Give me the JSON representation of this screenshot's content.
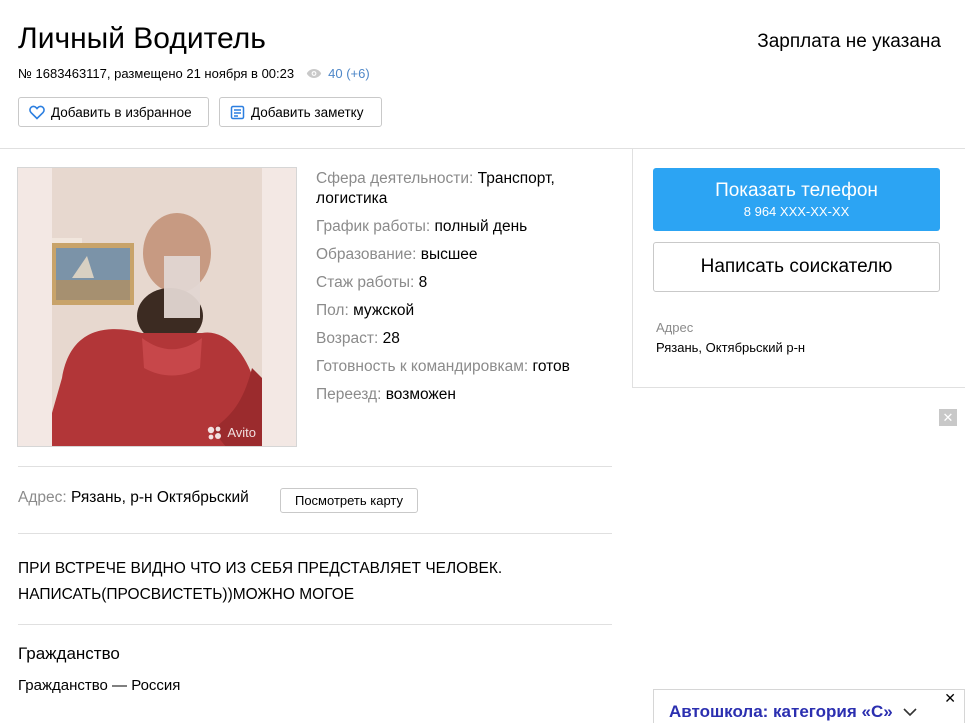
{
  "header": {
    "title": "Личный Водитель",
    "salary": "Зарплата не указана",
    "meta_text": "№ 1683463117, размещено 21 ноября в 00:23",
    "views": "40 (+6)"
  },
  "actions": {
    "favorite": "Добавить в избранное",
    "note": "Добавить заметку"
  },
  "photo": {
    "watermark": "Avito"
  },
  "properties": [
    {
      "key": "Сфера деятельности:",
      "value": "Транспорт, логистика"
    },
    {
      "key": "График работы:",
      "value": "полный день"
    },
    {
      "key": "Образование:",
      "value": "высшее"
    },
    {
      "key": "Стаж работы:",
      "value": "8"
    },
    {
      "key": "Пол:",
      "value": "мужской"
    },
    {
      "key": "Возраст:",
      "value": "28"
    },
    {
      "key": "Готовность к командировкам:",
      "value": "готов"
    },
    {
      "key": "Переезд:",
      "value": "возможен"
    }
  ],
  "address": {
    "label": "Адрес:",
    "value": "Рязань, р-н Октябрьский",
    "map_button": "Посмотреть карту"
  },
  "description": {
    "line1": "ПРИ ВСТРЕЧЕ ВИДНО ЧТО ИЗ СЕБЯ ПРЕДСТАВЛЯЕТ ЧЕЛОВЕК.",
    "line2": "НАПИСАТЬ(ПРОСВИСТЕТЬ))МОЖНО МОГОЕ"
  },
  "citizenship": {
    "heading": "Гражданство",
    "value": "Гражданство — Россия"
  },
  "sidebar": {
    "phone_button": "Показать телефон",
    "phone_number": "8 964 XXX-XX-XX",
    "write_button": "Написать соискателю",
    "address_label": "Адрес",
    "address_value": "Рязань, Октябрьский р-н"
  },
  "ad": {
    "close_label": "✕",
    "text": "Автошкола: категория «С»",
    "x_label": "✕"
  },
  "colors": {
    "accent": "#2ca4f3",
    "link": "#4e87c8",
    "ad_text": "#2b2fb0"
  }
}
